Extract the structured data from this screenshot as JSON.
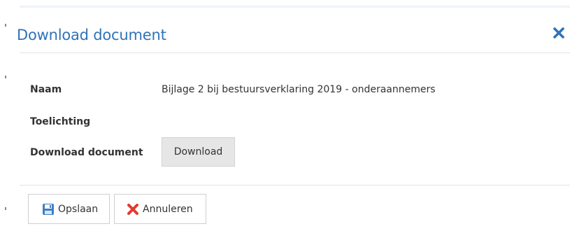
{
  "dialog": {
    "title": "Download document",
    "close_icon": "close-icon",
    "accent_color": "#2f73ba"
  },
  "fields": {
    "naam_label": "Naam",
    "naam_value": "Bijlage 2 bij bestuursverklaring 2019 - onderaannemers",
    "toelichting_label": "Toelichting",
    "toelichting_value": "",
    "download_label": "Download document",
    "download_button": "Download"
  },
  "footer": {
    "save_label": "Opslaan",
    "save_icon": "floppy-disk-icon",
    "cancel_label": "Annuleren",
    "cancel_icon": "red-x-icon",
    "cancel_icon_color": "#e03b2f"
  }
}
